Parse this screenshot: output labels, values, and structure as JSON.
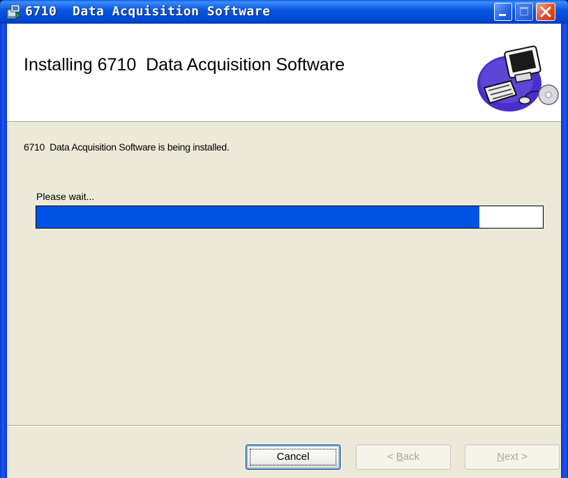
{
  "window": {
    "title": "6710  Data Acquisition Software",
    "icon": "installer-icon",
    "controls": [
      "minimize-icon",
      "maximize-icon",
      "close-icon"
    ]
  },
  "banner": {
    "title": "Installing 6710  Data Acquisition Software",
    "art": "computer-install-graphic"
  },
  "body": {
    "status": "6710  Data Acquisition Software is being installed.",
    "wait": "Please wait..."
  },
  "progress": {
    "fraction": 0.875
  },
  "buttons": {
    "cancel": "Cancel",
    "back_arrow": "< ",
    "back_mnemonic": "B",
    "back_rest": "ack",
    "next_mnemonic": "N",
    "next_rest": "ext",
    "next_arrow": " >"
  },
  "colors": {
    "progress_fill": "#0054e3",
    "titlebar": "#0046d5",
    "dialog_bg": "#ece9d8"
  }
}
